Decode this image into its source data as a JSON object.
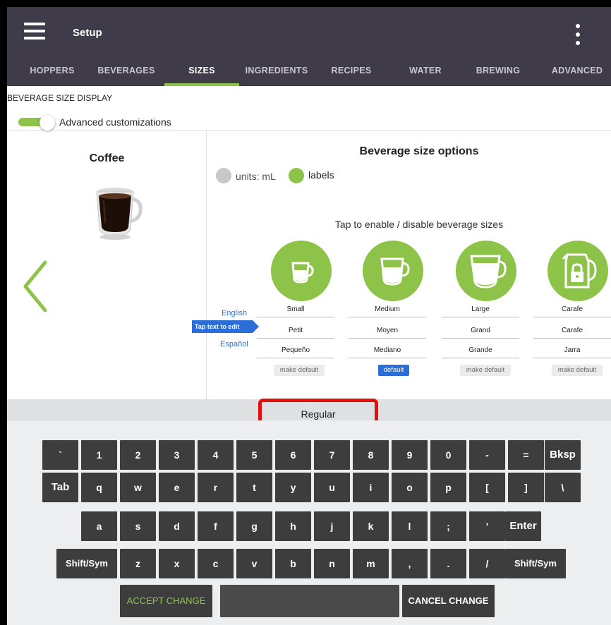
{
  "app_bar": {
    "title": "Setup"
  },
  "tabs": [
    {
      "label": "HOPPERS"
    },
    {
      "label": "BEVERAGES"
    },
    {
      "label": "SIZES"
    },
    {
      "label": "INGREDIENTS"
    },
    {
      "label": "RECIPES"
    },
    {
      "label": "WATER"
    },
    {
      "label": "BREWING"
    },
    {
      "label": "ADVANCED"
    }
  ],
  "active_tab": "SIZES",
  "section": {
    "title": "BEVERAGE SIZE DISPLAY",
    "toggle_label": "Advanced customizations",
    "toggle_on": true
  },
  "beverage": {
    "name": "Coffee"
  },
  "size_options": {
    "title": "Beverage size options",
    "units_label": "units: mL",
    "labels_label": "labels",
    "selected_mode": "labels",
    "instruction": "Tap to enable / disable beverage sizes",
    "lang_english": "English",
    "tap_text_hint": "Tap text to edit",
    "lang_spanish": "Español",
    "sizes": [
      {
        "icon": "small-cup-icon",
        "english": "Small",
        "french": "Petit",
        "spanish": "Pequeño",
        "default_label": "make default",
        "is_default": false
      },
      {
        "icon": "medium-cup-icon",
        "english": "Medium",
        "french": "Moyen",
        "spanish": "Mediano",
        "default_label": "default",
        "is_default": true
      },
      {
        "icon": "large-cup-icon",
        "english": "Large",
        "french": "Grand",
        "spanish": "Grande",
        "default_label": "make default",
        "is_default": false
      },
      {
        "icon": "carafe-lock-icon",
        "english": "Carafe",
        "french": "Carafe",
        "spanish": "Jarra",
        "default_label": "make default",
        "is_default": false
      }
    ]
  },
  "keyboard": {
    "preview_text": "Regular",
    "row1": [
      "`",
      "1",
      "2",
      "3",
      "4",
      "5",
      "6",
      "7",
      "8",
      "9",
      "0",
      "-",
      "=",
      "Bksp"
    ],
    "row2": [
      "Tab",
      "q",
      "w",
      "e",
      "r",
      "t",
      "y",
      "u",
      "i",
      "o",
      "p",
      "[",
      "]",
      "\\"
    ],
    "row3": [
      "a",
      "s",
      "d",
      "f",
      "g",
      "h",
      "j",
      "k",
      "l",
      ";",
      "'",
      "Enter"
    ],
    "row4": [
      "Shift/Sym",
      "z",
      "x",
      "c",
      "v",
      "b",
      "n",
      "m",
      ",",
      ".",
      "/",
      "Shift/Sym"
    ],
    "accept_label": "ACCEPT CHANGE",
    "cancel_label": "CANCEL CHANGE"
  },
  "colors": {
    "app_bar": "#403b48",
    "accent_green": "#8ec34a",
    "link_blue": "#3a72c4",
    "default_blue": "#2b6ed8",
    "highlight_red": "#e01010",
    "key_dark": "#3d3d3d"
  }
}
